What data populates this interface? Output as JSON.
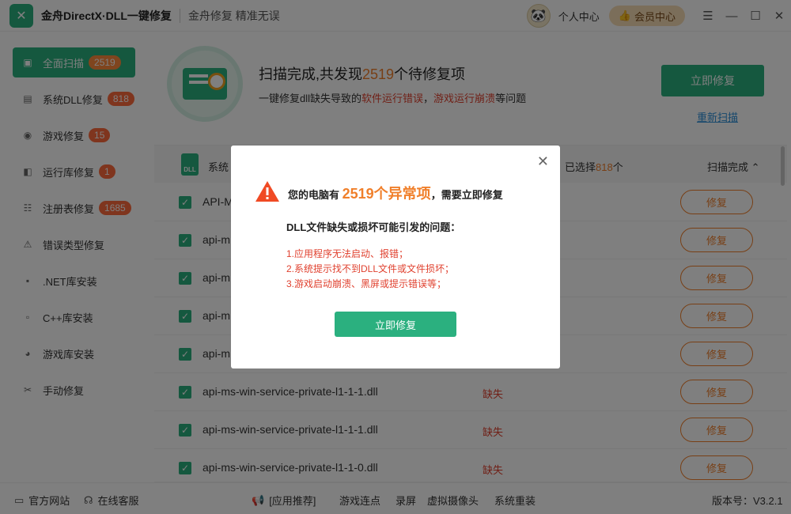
{
  "app": {
    "title": "金舟DirectX·DLL一键修复",
    "slogan": "金舟修复 精准无误",
    "personal_center": "个人中心",
    "vip_center": "会员中心"
  },
  "sidebar": {
    "items": [
      {
        "label": "全面扫描",
        "badge": "2519",
        "icon": "scan-icon"
      },
      {
        "label": "系统DLL修复",
        "badge": "818",
        "icon": "dll-icon"
      },
      {
        "label": "游戏修复",
        "badge": "15",
        "icon": "gamepad-icon"
      },
      {
        "label": "运行库修复",
        "badge": "1",
        "icon": "runtime-icon"
      },
      {
        "label": "注册表修复",
        "badge": "1685",
        "icon": "registry-icon"
      },
      {
        "label": "错误类型修复",
        "badge": "",
        "icon": "warning-icon"
      },
      {
        "label": ".NET库安装",
        "badge": "",
        "icon": "dotnet-icon"
      },
      {
        "label": "C++库安装",
        "badge": "",
        "icon": "cpp-icon"
      },
      {
        "label": "游戏库安装",
        "badge": "",
        "icon": "pacman-icon"
      },
      {
        "label": "手动修复",
        "badge": "",
        "icon": "wrench-icon"
      }
    ]
  },
  "header": {
    "title_prefix": "扫描完成,共发现",
    "count": "2519",
    "title_suffix": "个待修复项",
    "sub_prefix": "一键修复dll缺失导致的",
    "sub_red1": "软件运行错误",
    "sub_mid": "，",
    "sub_red2": "游戏运行崩溃",
    "sub_suffix": "等问题",
    "fix_now": "立即修复",
    "rescan": "重新扫描"
  },
  "list": {
    "header_label": "系统",
    "selected_prefix": "已选择",
    "selected_count": "818",
    "selected_suffix": "个",
    "scan_done": "扫描完成",
    "rows": [
      {
        "name": "API-M",
        "status": "",
        "action": "修复"
      },
      {
        "name": "api-m",
        "status": "",
        "action": "修复"
      },
      {
        "name": "api-m",
        "status": "",
        "action": "修复"
      },
      {
        "name": "api-m",
        "status": "",
        "action": "修复"
      },
      {
        "name": "api-m",
        "status": "",
        "action": "修复"
      },
      {
        "name": "api-ms-win-service-private-l1-1-1.dll",
        "status": "缺失",
        "action": "修复"
      },
      {
        "name": "api-ms-win-service-private-l1-1-1.dll",
        "status": "缺失",
        "action": "修复"
      },
      {
        "name": "api-ms-win-service-private-l1-1-0.dll",
        "status": "缺失",
        "action": "修复"
      }
    ]
  },
  "footer": {
    "official_site": "官方网站",
    "online_service": "在线客服",
    "app_recommend": "[应用推荐]",
    "links": [
      "游戏连点",
      "录屏",
      "虚拟摄像头",
      "系统重装"
    ],
    "version": "版本号：V3.2.1"
  },
  "modal": {
    "title_prefix": "您的电脑有",
    "title_count": "2519个异常项",
    "title_suffix": "，需要立即修复",
    "subtitle": "DLL文件缺失或损坏可能引发的问题：",
    "issues": [
      "1.应用程序无法启动、报错；",
      "2.系统提示找不到DLL文件或文件损坏；",
      "3.游戏启动崩溃、黑屏或提示错误等；"
    ],
    "button": "立即修复"
  },
  "colors": {
    "accent": "#2bb07f",
    "highlight": "#f07f2a",
    "error": "#e0412f",
    "badge": "#ff6a3d"
  }
}
